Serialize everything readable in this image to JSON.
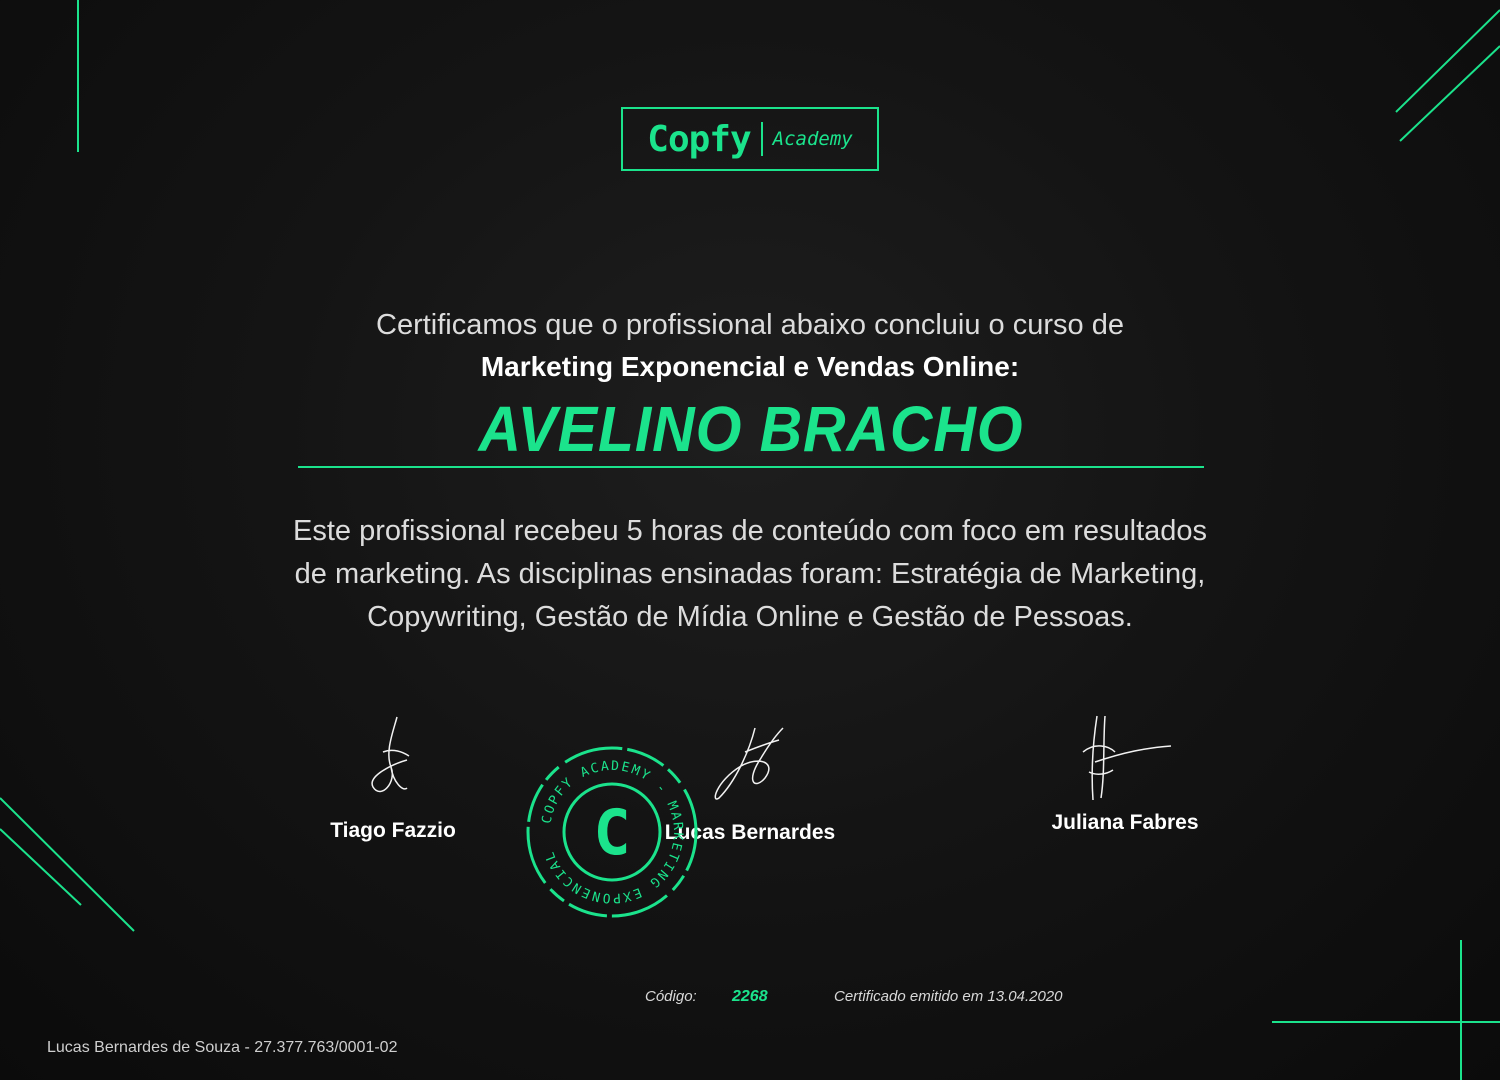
{
  "logo": {
    "brand": "Copfy",
    "sub": "Academy"
  },
  "certificate": {
    "intro": "Certificamos que o profissional abaixo concluiu o curso de",
    "course": "Marketing Exponencial e Vendas Online:",
    "recipient": "AVELINO BRACHO",
    "description_lines": [
      "Este profissional recebeu 5 horas de conteúdo com foco em resultados",
      "de marketing. As disciplinas ensinadas foram: Estratégia de Marketing,",
      "Copywriting, Gestão de Mídia Online e Gestão de Pessoas."
    ]
  },
  "signatures": [
    {
      "name": "Tiago Fazzio"
    },
    {
      "name": "Lucas Bernardes"
    },
    {
      "name": "Juliana Fabres"
    }
  ],
  "seal": {
    "letter": "C",
    "ring_text": "COPFY ACADEMY - MARKETING EXPONENCIAL"
  },
  "footer": {
    "code_label": "Código:",
    "code_value": "2268",
    "issued_label": "Certificado emitido em",
    "issued_date": "13.04.2020",
    "company": "Lucas Bernardes de Souza - 27.377.763/0001-02"
  },
  "colors": {
    "accent": "#1be38c",
    "background": "#111111"
  }
}
